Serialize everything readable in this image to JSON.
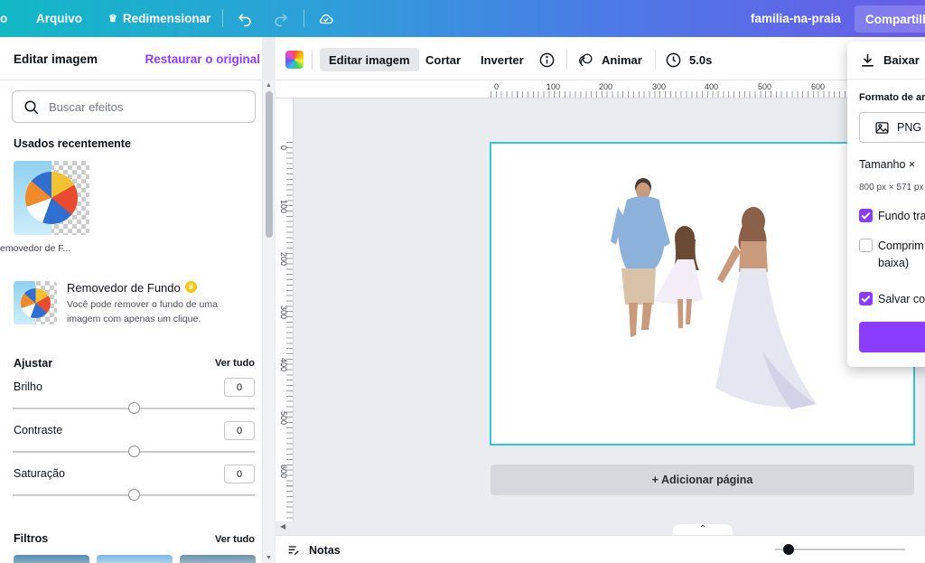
{
  "topbar": {
    "home_partial": "o",
    "file_menu": "Arquivo",
    "resize": "Redimensionar",
    "doc_title": "familia-na-praia",
    "share": "Compartilh"
  },
  "left_panel": {
    "title": "Editar imagem",
    "restore": "Restaurar o original",
    "search_placeholder": "Buscar efeitos",
    "recent_title": "Usados recentemente",
    "recent_item_label": "emovedor de F...",
    "bg_remover_title": "Removedor de Fundo",
    "bg_remover_desc_line1": "Você pode remover o fundo de uma",
    "bg_remover_desc_line2": "imagem com apenas um clique.",
    "adjust_title": "Ajustar",
    "see_all": "Ver tudo",
    "adjustments": [
      {
        "label": "Brilho",
        "value": "0",
        "level": 0
      },
      {
        "label": "Contraste",
        "value": "0",
        "level": 0
      },
      {
        "label": "Saturação",
        "value": "0",
        "level": 0
      }
    ],
    "filters_title": "Filtros",
    "filters_see_all": "Ver tudo"
  },
  "context_toolbar": {
    "edit_image": "Editar imagem",
    "crop": "Cortar",
    "flip": "Inverter",
    "animate": "Animar",
    "duration": "5.0s"
  },
  "ruler": {
    "top_ticks": [
      "0",
      "100",
      "200",
      "300",
      "400",
      "500",
      "600"
    ],
    "left_ticks": [
      "0",
      "100",
      "200",
      "300",
      "400",
      "500",
      "600"
    ]
  },
  "canvas": {
    "add_page": "+ Adicionar página"
  },
  "bottom_bar": {
    "notes": "Notas",
    "zoom_level": 0.06
  },
  "download_popover": {
    "title": "Baixar",
    "format_label": "Formato de ar",
    "format_value": "PNG",
    "size_label": "Tamanho ×",
    "size_value": "800 px × 571 px",
    "transparent_bg": "Fundo tra",
    "transparent_bg_checked": true,
    "compress_line1": "Comprim",
    "compress_line2": "baixa)",
    "compress_checked": false,
    "save_settings": "Salvar co",
    "save_settings_checked": true
  },
  "colors": {
    "accent": "#8b3dff",
    "selection": "#33c6d6",
    "topbar_start": "#12b8c6",
    "topbar_end": "#6a5ce8"
  }
}
